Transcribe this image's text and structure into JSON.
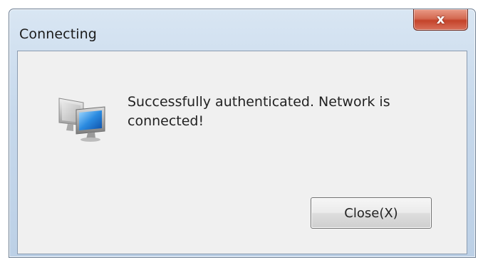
{
  "window": {
    "title": "Connecting",
    "close_glyph": "x"
  },
  "dialog": {
    "icon": "network-computer-icon",
    "message": "Successfully authenticated. Network is connected!",
    "close_button_label": "Close(X)"
  },
  "colors": {
    "titlebar": "#c7d9ec",
    "close_button_red": "#c4432a",
    "content_bg": "#f0f0f0"
  }
}
